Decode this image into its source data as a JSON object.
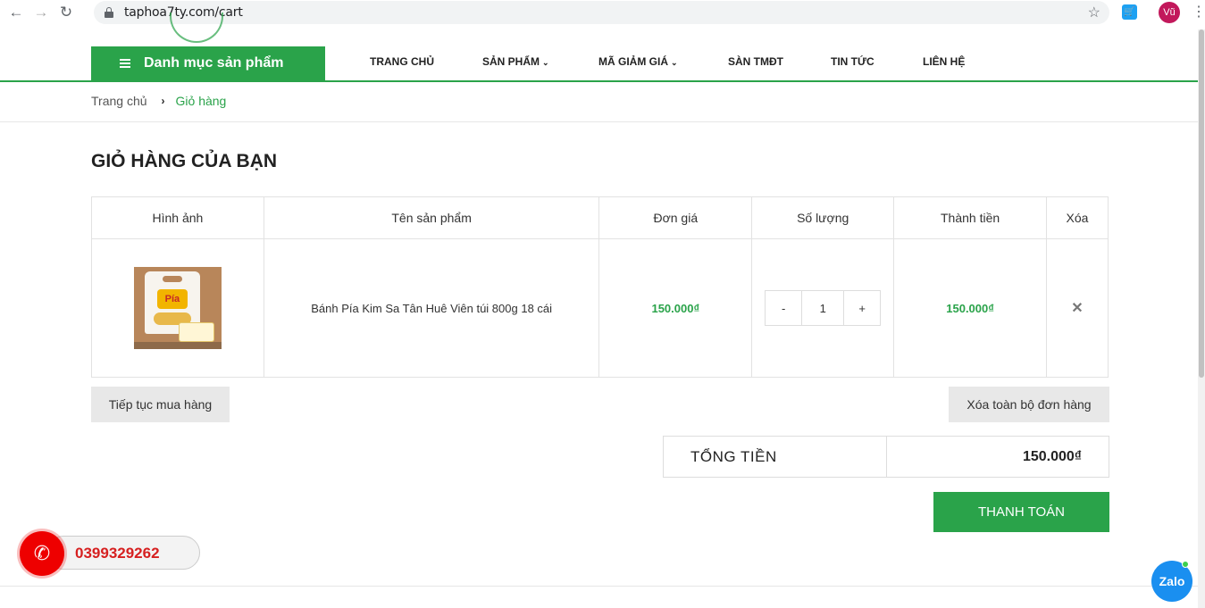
{
  "browser": {
    "url": "taphoa7ty.com/cart",
    "profile_initials": "Vũ",
    "icons": {
      "back": "arrow-left-icon",
      "forward": "arrow-right-icon",
      "reload": "reload-icon",
      "lock": "lock-icon",
      "bookmark": "star-icon",
      "menu": "kebab-icon"
    }
  },
  "header": {
    "category_label": "Danh mục sản phẩm",
    "menu": [
      {
        "label": "TRANG CHỦ",
        "has_caret": false
      },
      {
        "label": "SẢN PHẨM",
        "has_caret": true
      },
      {
        "label": "MÃ GIẢM GIÁ",
        "has_caret": true
      },
      {
        "label": "SÀN TMĐT",
        "has_caret": false
      },
      {
        "label": "TIN TỨC",
        "has_caret": false
      },
      {
        "label": "LIÊN HỆ",
        "has_caret": false
      }
    ]
  },
  "breadcrumb": {
    "home": "Trang chủ",
    "separator": "›",
    "current": "Giỏ hàng"
  },
  "page_title": "GIỎ HÀNG CỦA BẠN",
  "table": {
    "headers": [
      "Hình ảnh",
      "Tên sản phẩm",
      "Đơn giá",
      "Số lượng",
      "Thành tiền",
      "Xóa"
    ],
    "rows": [
      {
        "name": "Bánh Pía Kim Sa Tân Huê Viên túi 800g 18 cái",
        "thumb_logo": "Pía",
        "unit_price": "150.000₫",
        "quantity": "1",
        "minus": "-",
        "plus": "+",
        "subtotal": "150.000₫",
        "remove": "✕"
      }
    ]
  },
  "actions": {
    "continue": "Tiếp tục mua hàng",
    "clear": "Xóa toàn bộ đơn hàng",
    "checkout": "THANH TOÁN"
  },
  "total": {
    "label": "TỔNG TIỀN",
    "value": "150.000₫"
  },
  "hotline": {
    "number": "0399329262"
  },
  "zalo": {
    "label": "Zalo"
  },
  "colors": {
    "brand_green": "#2aa34a",
    "hotline_red": "#e00000",
    "zalo_blue": "#1a8ff0"
  }
}
